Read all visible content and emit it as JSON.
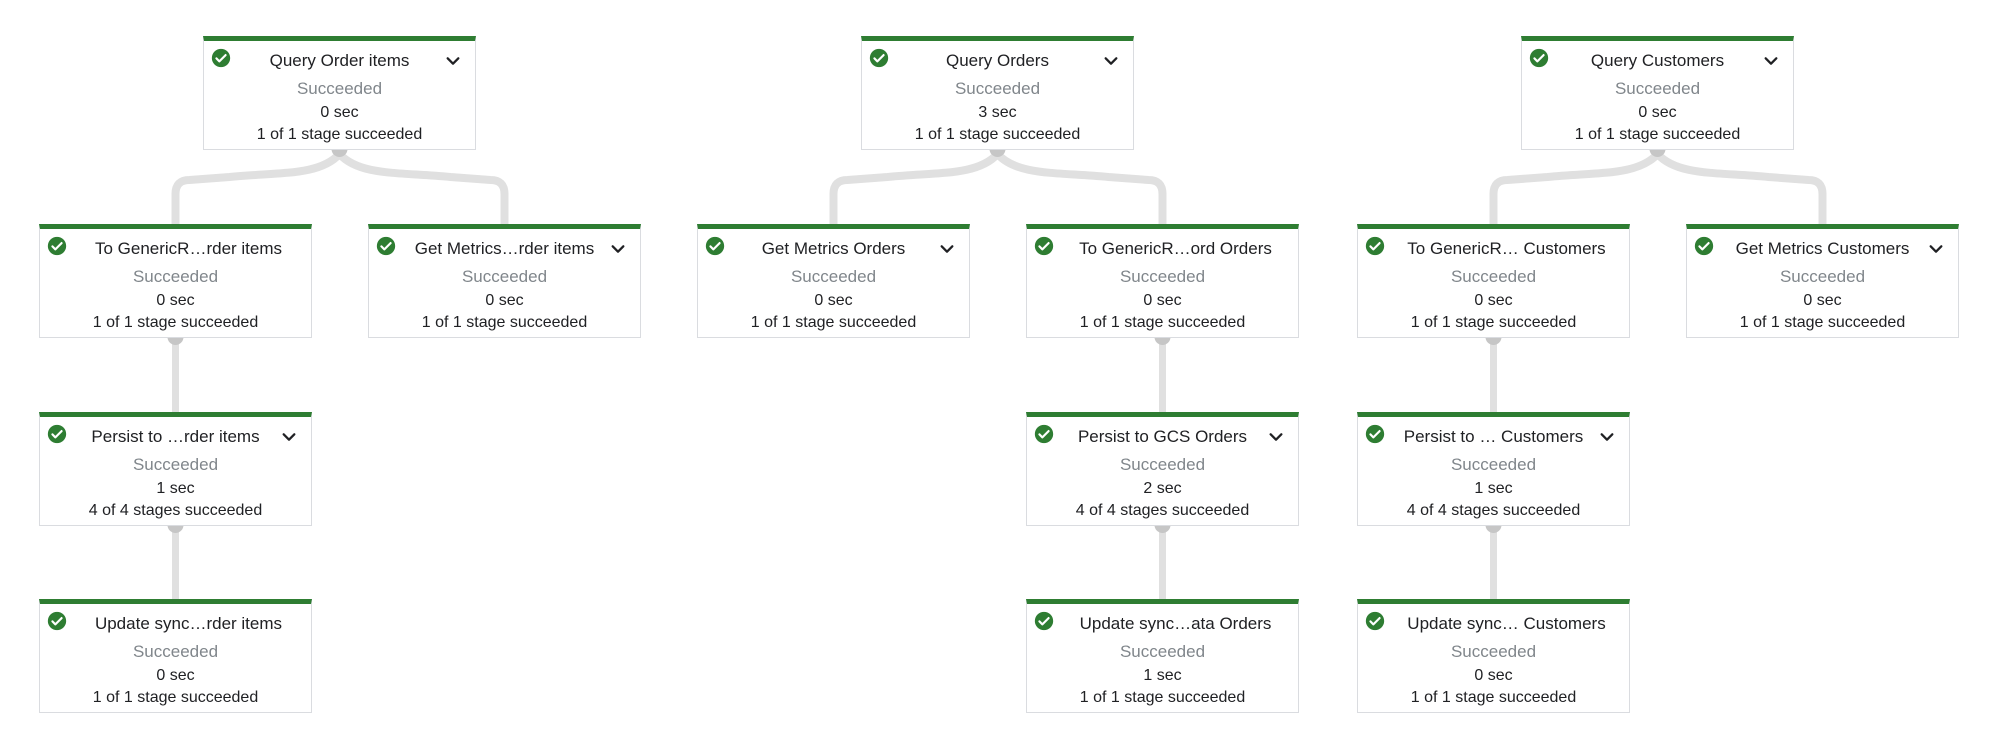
{
  "colors": {
    "success": "#2e7d32",
    "edge": "#e0e0e0",
    "knob": "#c6c6c6"
  },
  "graphs": [
    {
      "name": "order-items",
      "nodes": [
        {
          "id": "q",
          "title": "Query Order items",
          "status": "Succeeded",
          "duration": "0 sec",
          "stages": "1 of 1 stage succeeded",
          "expandable": true,
          "icon": "check-circle-icon"
        },
        {
          "id": "a",
          "title": "To GenericR…rder items",
          "status": "Succeeded",
          "duration": "0 sec",
          "stages": "1 of 1 stage succeeded",
          "expandable": false,
          "icon": "check-circle-icon"
        },
        {
          "id": "b",
          "title": "Get Metrics…rder items",
          "status": "Succeeded",
          "duration": "0 sec",
          "stages": "1 of 1 stage succeeded",
          "expandable": true,
          "icon": "check-circle-icon"
        },
        {
          "id": "c",
          "title": "Persist to …rder items",
          "status": "Succeeded",
          "duration": "1 sec",
          "stages": "4 of 4 stages succeeded",
          "expandable": true,
          "icon": "check-circle-icon"
        },
        {
          "id": "d",
          "title": "Update sync…rder items",
          "status": "Succeeded",
          "duration": "0 sec",
          "stages": "1 of 1 stage succeeded",
          "expandable": false,
          "icon": "check-circle-icon"
        }
      ],
      "edges": [
        [
          "q",
          "a"
        ],
        [
          "q",
          "b"
        ],
        [
          "a",
          "c"
        ],
        [
          "c",
          "d"
        ]
      ]
    },
    {
      "name": "orders",
      "nodes": [
        {
          "id": "q",
          "title": "Query Orders",
          "status": "Succeeded",
          "duration": "3 sec",
          "stages": "1 of 1 stage succeeded",
          "expandable": true,
          "icon": "check-circle-icon"
        },
        {
          "id": "a",
          "title": "Get Metrics Orders",
          "status": "Succeeded",
          "duration": "0 sec",
          "stages": "1 of 1 stage succeeded",
          "expandable": true,
          "icon": "check-circle-icon"
        },
        {
          "id": "b",
          "title": "To GenericR…ord Orders",
          "status": "Succeeded",
          "duration": "0 sec",
          "stages": "1 of 1 stage succeeded",
          "expandable": false,
          "icon": "check-circle-icon"
        },
        {
          "id": "c",
          "title": "Persist to GCS Orders",
          "status": "Succeeded",
          "duration": "2 sec",
          "stages": "4 of 4 stages succeeded",
          "expandable": true,
          "icon": "check-circle-icon"
        },
        {
          "id": "d",
          "title": "Update sync…ata Orders",
          "status": "Succeeded",
          "duration": "1 sec",
          "stages": "1 of 1 stage succeeded",
          "expandable": false,
          "icon": "check-circle-icon"
        }
      ],
      "edges": [
        [
          "q",
          "a"
        ],
        [
          "q",
          "b"
        ],
        [
          "b",
          "c"
        ],
        [
          "c",
          "d"
        ]
      ]
    },
    {
      "name": "customers",
      "nodes": [
        {
          "id": "q",
          "title": "Query Customers",
          "status": "Succeeded",
          "duration": "0 sec",
          "stages": "1 of 1 stage succeeded",
          "expandable": true,
          "icon": "check-circle-icon"
        },
        {
          "id": "a",
          "title": "To GenericR… Customers",
          "status": "Succeeded",
          "duration": "0 sec",
          "stages": "1 of 1 stage succeeded",
          "expandable": false,
          "icon": "check-circle-icon"
        },
        {
          "id": "b",
          "title": "Get Metrics Customers",
          "status": "Succeeded",
          "duration": "0 sec",
          "stages": "1 of 1 stage succeeded",
          "expandable": true,
          "icon": "check-circle-icon"
        },
        {
          "id": "c",
          "title": "Persist to … Customers",
          "status": "Succeeded",
          "duration": "1 sec",
          "stages": "4 of 4 stages succeeded",
          "expandable": true,
          "icon": "check-circle-icon"
        },
        {
          "id": "d",
          "title": "Update sync… Customers",
          "status": "Succeeded",
          "duration": "0 sec",
          "stages": "1 of 1 stage succeeded",
          "expandable": false,
          "icon": "check-circle-icon"
        }
      ],
      "edges": [
        [
          "q",
          "a"
        ],
        [
          "q",
          "b"
        ],
        [
          "a",
          "c"
        ],
        [
          "c",
          "d"
        ]
      ]
    }
  ]
}
